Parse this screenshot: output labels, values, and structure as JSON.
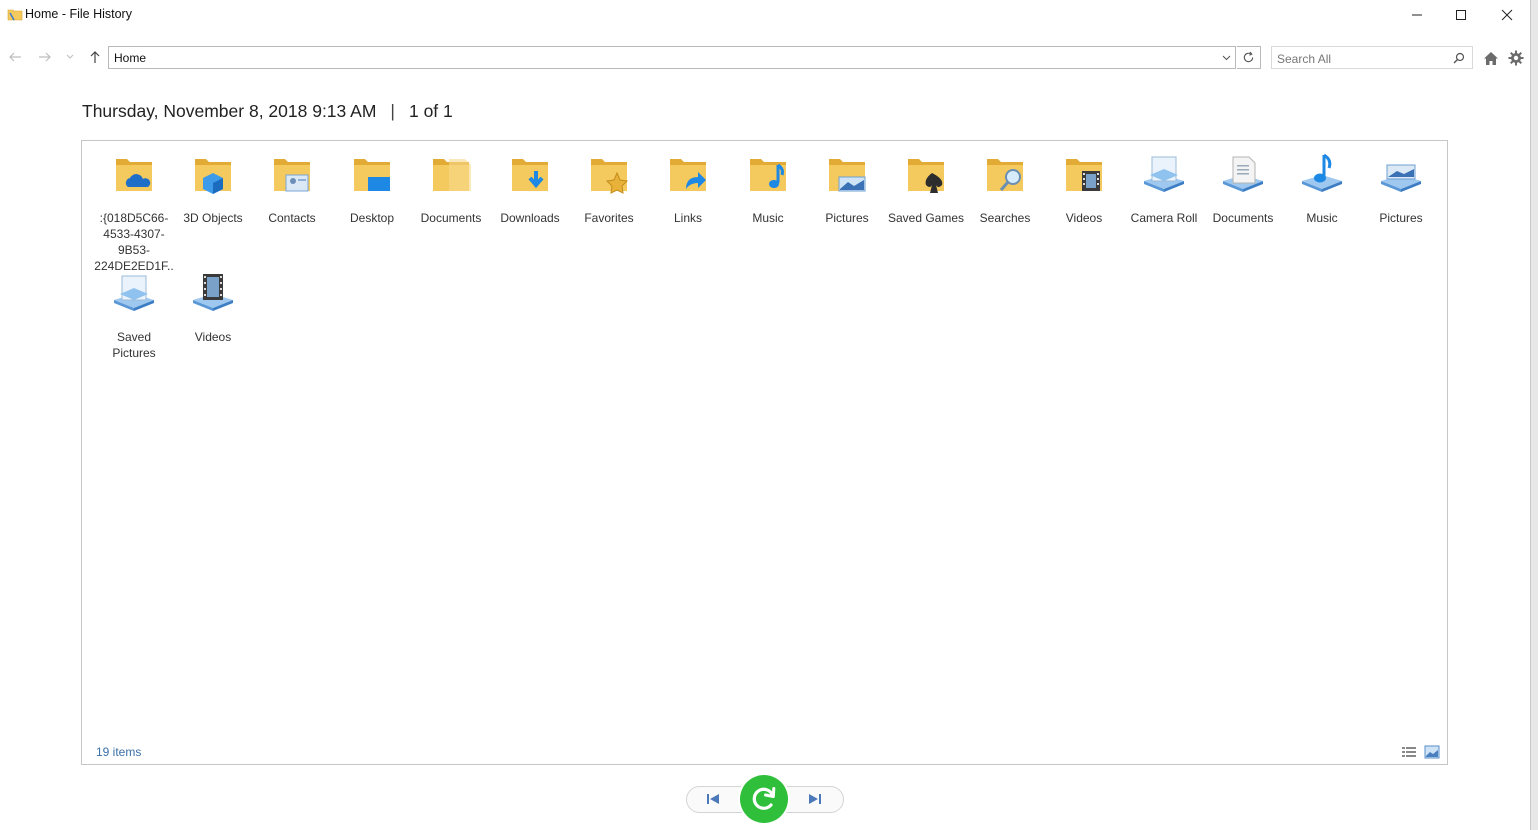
{
  "window": {
    "title": "Home - File History"
  },
  "nav": {
    "address": "Home",
    "search_placeholder": "Search All"
  },
  "header": {
    "datetime": "Thursday, November 8, 2018 9:13 AM",
    "separator": "|",
    "page": "1 of 1"
  },
  "items": [
    {
      "label": ":{018D5C66-4533-4307-9B53-224DE2ED1F...",
      "icon": "onedrive-folder-icon"
    },
    {
      "label": "3D Objects",
      "icon": "3d-objects-folder-icon"
    },
    {
      "label": "Contacts",
      "icon": "contacts-folder-icon"
    },
    {
      "label": "Desktop",
      "icon": "desktop-folder-icon"
    },
    {
      "label": "Documents",
      "icon": "documents-folder-icon"
    },
    {
      "label": "Downloads",
      "icon": "downloads-folder-icon"
    },
    {
      "label": "Favorites",
      "icon": "favorites-folder-icon"
    },
    {
      "label": "Links",
      "icon": "links-folder-icon"
    },
    {
      "label": "Music",
      "icon": "music-folder-icon"
    },
    {
      "label": "Pictures",
      "icon": "pictures-folder-icon"
    },
    {
      "label": "Saved Games",
      "icon": "saved-games-folder-icon"
    },
    {
      "label": "Searches",
      "icon": "searches-folder-icon"
    },
    {
      "label": "Videos",
      "icon": "videos-folder-icon"
    },
    {
      "label": "Camera Roll",
      "icon": "camera-roll-library-icon"
    },
    {
      "label": "Documents",
      "icon": "documents-library-icon"
    },
    {
      "label": "Music",
      "icon": "music-library-icon"
    },
    {
      "label": "Pictures",
      "icon": "pictures-library-icon"
    },
    {
      "label": "Saved Pictures",
      "icon": "saved-pictures-library-icon"
    },
    {
      "label": "Videos",
      "icon": "videos-library-icon"
    }
  ],
  "status": {
    "count": "19 items"
  },
  "colors": {
    "folder": "#f4c95d",
    "folder_dark": "#e2ab35",
    "accent_blue": "#1e88e5",
    "restore_green": "#2fbf3b",
    "status_text": "#3b6fa8"
  }
}
